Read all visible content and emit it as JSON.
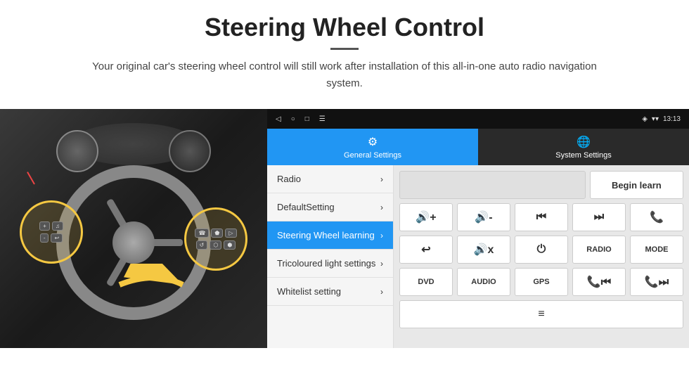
{
  "header": {
    "title": "Steering Wheel Control",
    "divider": true,
    "subtitle": "Your original car's steering wheel control will still work after installation of this all-in-one auto radio navigation system."
  },
  "android": {
    "status_bar": {
      "back_icon": "◁",
      "home_icon": "○",
      "recent_icon": "□",
      "menu_icon": "☰",
      "wifi_icon": "▾",
      "signal_icon": "▾",
      "time": "13:13"
    },
    "tabs": [
      {
        "id": "general",
        "label": "General Settings",
        "icon": "⚙",
        "active": true
      },
      {
        "id": "system",
        "label": "System Settings",
        "icon": "🌐",
        "active": false
      }
    ],
    "menu_items": [
      {
        "id": "radio",
        "label": "Radio",
        "active": false
      },
      {
        "id": "default",
        "label": "DefaultSetting",
        "active": false
      },
      {
        "id": "steering",
        "label": "Steering Wheel learning",
        "active": true
      },
      {
        "id": "tricoloured",
        "label": "Tricoloured light settings",
        "active": false
      },
      {
        "id": "whitelist",
        "label": "Whitelist setting",
        "active": false
      }
    ],
    "control_panel": {
      "begin_learn": "Begin learn",
      "buttons": {
        "row1": [
          "🔊+",
          "🔊-",
          "⏮",
          "⏭",
          "📞"
        ],
        "row2": [
          "↩",
          "🔊x",
          "⏻",
          "RADIO",
          "MODE"
        ],
        "row3": [
          "DVD",
          "AUDIO",
          "GPS",
          "📞⏮",
          "📞⏭"
        ],
        "row4_icon": "≡"
      }
    }
  }
}
